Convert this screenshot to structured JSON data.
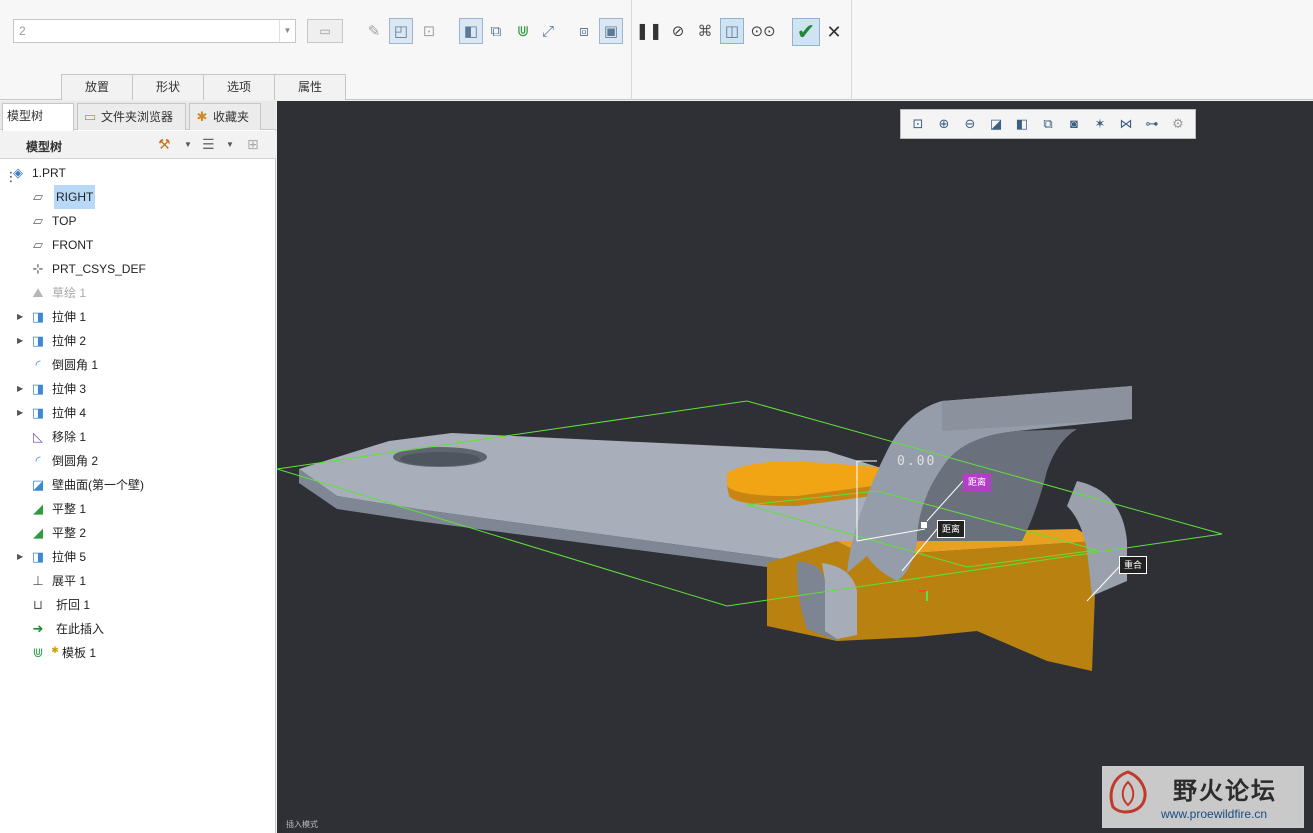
{
  "ribbon": {
    "combo_value": "2",
    "tabs": [
      "放置",
      "形状",
      "选项",
      "属性"
    ]
  },
  "panel": {
    "tabs": [
      "模型树",
      "文件夹浏览器",
      "收藏夹"
    ],
    "tree_title": "模型树",
    "items": [
      {
        "label": "1.PRT",
        "icon": "part-icon"
      },
      {
        "label": "RIGHT",
        "icon": "datum-plane-icon"
      },
      {
        "label": "TOP",
        "icon": "datum-plane-icon"
      },
      {
        "label": "FRONT",
        "icon": "datum-plane-icon"
      },
      {
        "label": "PRT_CSYS_DEF",
        "icon": "csys-icon"
      },
      {
        "label": "草绘 1",
        "icon": "sketch-icon"
      },
      {
        "label": "拉伸 1",
        "icon": "extrude-icon"
      },
      {
        "label": "拉伸 2",
        "icon": "extrude-icon"
      },
      {
        "label": "倒圆角 1",
        "icon": "round-icon"
      },
      {
        "label": "拉伸 3",
        "icon": "extrude-icon"
      },
      {
        "label": "拉伸 4",
        "icon": "extrude-icon"
      },
      {
        "label": "移除 1",
        "icon": "remove-icon"
      },
      {
        "label": "倒圆角 2",
        "icon": "round-icon"
      },
      {
        "label": "壁曲面(第一个壁)",
        "icon": "wall-icon"
      },
      {
        "label": "平整 1",
        "icon": "flat-wall-icon"
      },
      {
        "label": "平整 2",
        "icon": "flat-wall-icon"
      },
      {
        "label": "拉伸 5",
        "icon": "extrude-icon"
      },
      {
        "label": "展平 1",
        "icon": "unbend-icon"
      },
      {
        "label": "折回 1",
        "icon": "bend-back-icon"
      },
      {
        "label": "在此插入",
        "icon": "insert-here-icon"
      },
      {
        "label": "模板 1",
        "icon": "form-icon"
      }
    ]
  },
  "viewport": {
    "dimension_value": "0.00",
    "tags": [
      "距离",
      "距离",
      "重合"
    ],
    "status": "插入模式"
  },
  "watermark": {
    "title": "野火论坛",
    "url": "www.proewildfire.cn"
  },
  "colors": {
    "viewport_bg": "#2f3035",
    "part_gray": "#a6adb8",
    "part_orange": "#e39a15",
    "plane_green": "#5fe03a",
    "tag_magenta": "#b23fc7",
    "selection": "#b7d8f7"
  }
}
